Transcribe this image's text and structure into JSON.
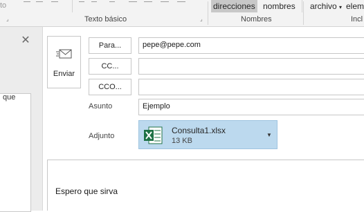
{
  "ribbon": {
    "fragment_left": "to",
    "buttons": {
      "direcciones": "direcciones",
      "nombres": "nombres",
      "archivo": "archivo",
      "elementos": "elem"
    },
    "groups": {
      "texto_basico": "Texto básico",
      "nombres": "Nombres",
      "incluir": "Incl"
    }
  },
  "left_pane": {
    "fragment_text": "que"
  },
  "compose": {
    "send_label": "Enviar",
    "to_button": "Para...",
    "cc_button": "CC...",
    "bcc_button": "CCO...",
    "to_value": "pepe@pepe.com",
    "cc_value": "",
    "bcc_value": "",
    "subject_label": "Asunto",
    "subject_value": "Ejemplo",
    "attachment_label": "Adjunto",
    "attachment": {
      "name": "Consulta1.xlsx",
      "size": "13 KB",
      "icon": "excel-file-icon"
    },
    "body_text": "Espero que sirva"
  },
  "colors": {
    "attachment_bg": "#bcd9ee",
    "excel_green": "#1e7145",
    "selected_ribbon": "#c8c8c8"
  }
}
